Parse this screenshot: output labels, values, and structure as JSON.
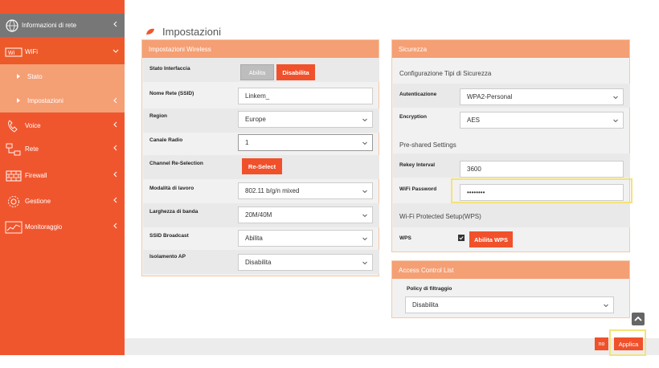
{
  "sidebar": {
    "top": {
      "label": "Informazioni di rete",
      "icon": "globe-icon"
    },
    "items": [
      {
        "label": "WiFi",
        "icon": "wifi-icon"
      },
      {
        "label": "Stato"
      },
      {
        "label": "Impostazioni"
      },
      {
        "label": "Voice",
        "icon": "phone-icon"
      },
      {
        "label": "Rete",
        "icon": "network-icon"
      },
      {
        "label": "Firewall",
        "icon": "firewall-icon"
      },
      {
        "label": "Gestione",
        "icon": "gear-icon"
      },
      {
        "label": "Monitoraggio",
        "icon": "chart-icon"
      }
    ]
  },
  "page": {
    "title": "Impostazioni"
  },
  "wireless": {
    "title": "Impostazioni Wireless",
    "rows": {
      "stato": "Stato Interfaccia",
      "ssid": "Nome Rete (SSID)",
      "region": "Region",
      "canale": "Canale Radio",
      "reselect": "Channel Re-Selection",
      "modalita": "Modalità di lavoro",
      "banda": "Larghezza di banda",
      "broadcast": "SSID Broadcast",
      "isolamento": "Isolamento AP"
    },
    "abilita_btn": "Abilita",
    "disabilita_btn": "Disabilita",
    "ssid_value": "Linkem_",
    "region_value": "Europe",
    "canale_value": "1",
    "reselect_btn": "Re-Select",
    "modalita_value": "802.11 b/g/n mixed",
    "banda_value": "20M/40M",
    "broadcast_value": "Abilita",
    "isolamento_value": "Disabilita"
  },
  "security": {
    "title": "Sicurezza",
    "config_label": "Configurazione Tipi di Sicurezza",
    "auth_label": "Autenticazione",
    "auth_value": "WPA2-Personal",
    "enc_label": "Encryption",
    "enc_value": "AES",
    "psk_label": "Pre-shared Settings",
    "rekey_label": "Rekey Interval",
    "rekey_value": "3600",
    "pwd_label": "WiFi Password",
    "pwd_value": "••••••••",
    "wps_section": "Wi-Fi Protected Setup(WPS)",
    "wps_label": "WPS",
    "wps_btn": "Abilita WPS"
  },
  "acl": {
    "title": "Access Control List",
    "policy_label": "Policy di filtraggio",
    "policy_value": "Disabilita"
  },
  "footer": {
    "no_btn": "no",
    "apply_btn": "Applica"
  },
  "colors": {
    "accent": "#f0562e",
    "panel_head": "#f59f74",
    "highlight": "#f5e27a"
  }
}
